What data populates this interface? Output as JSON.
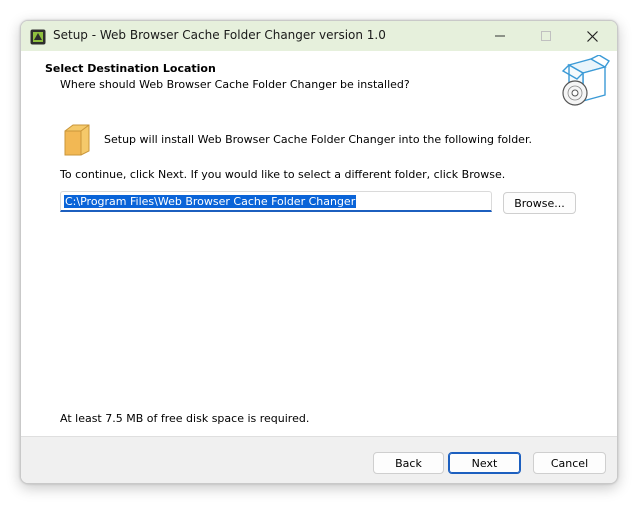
{
  "window": {
    "title": "Setup - Web Browser Cache Folder Changer version 1.0",
    "title_bar_color": "#e6f0dc"
  },
  "header": {
    "title": "Select Destination Location",
    "subtitle": "Where should Web Browser Cache Folder Changer be installed?",
    "icon": "box-with-disc-icon"
  },
  "body": {
    "install_text": "Setup will install Web Browser Cache Folder Changer into the following folder.",
    "continue_text": "To continue, click Next. If you would like to select a different folder, click Browse.",
    "path_value": "C:\\Program Files\\Web Browser Cache Folder Changer",
    "browse_label": "Browse...",
    "disk_space_text": "At least 7.5 MB of free disk space is required.",
    "folder_icon": "folder-icon"
  },
  "footer": {
    "back_label": "Back",
    "next_label": "Next",
    "cancel_label": "Cancel"
  },
  "colors": {
    "accent": "#1c5fbf",
    "selection": "#0a64d8",
    "footer_bg": "#f0f0f0"
  }
}
